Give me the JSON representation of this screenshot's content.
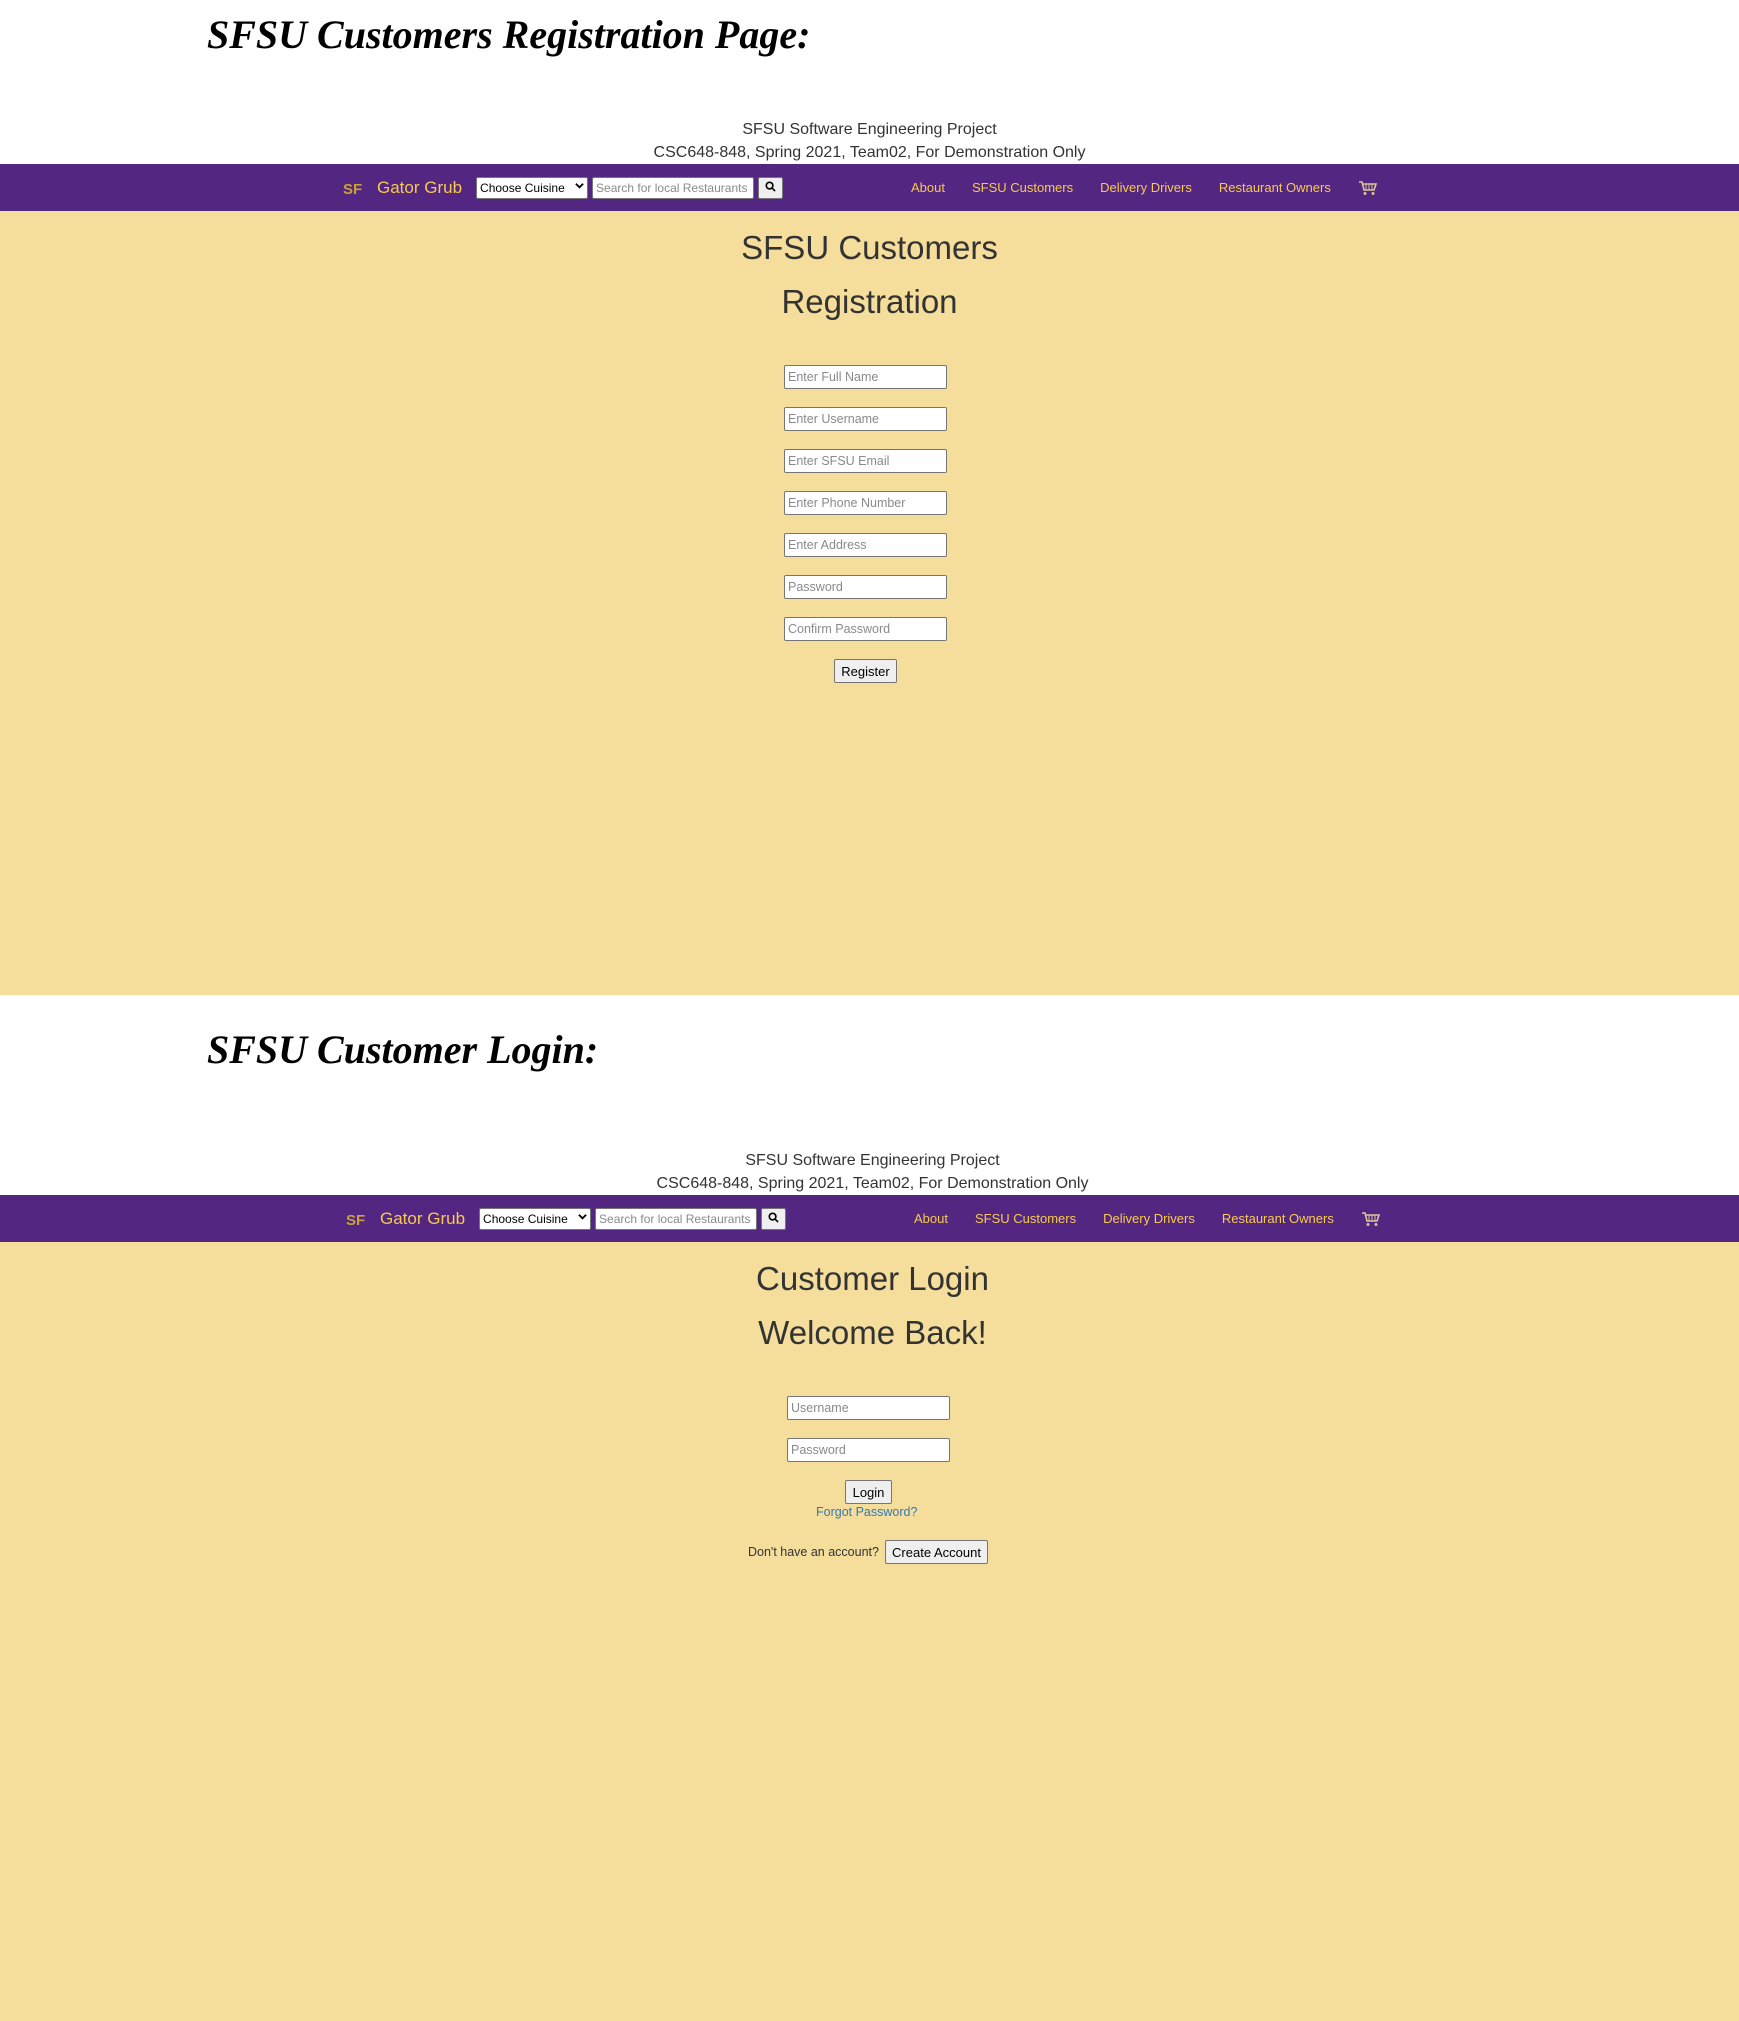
{
  "registration_section": {
    "heading": "SFSU Customers Registration Page:",
    "project_info": {
      "line1": "SFSU Software Engineering Project",
      "line2": "CSC648-848, Spring 2021, Team02, For Demonstration Only"
    },
    "navbar": {
      "brand": "Gator Grub",
      "cuisine_select": "Choose Cuisine",
      "search_placeholder": "Search for local Restaurants",
      "links": [
        "About",
        "SFSU Customers",
        "Delivery Drivers",
        "Restaurant Owners"
      ]
    },
    "title_line1": "SFSU Customers",
    "title_line2": "Registration",
    "fields": [
      {
        "placeholder": "Enter Full Name"
      },
      {
        "placeholder": "Enter Username"
      },
      {
        "placeholder": "Enter SFSU Email"
      },
      {
        "placeholder": "Enter Phone Number"
      },
      {
        "placeholder": "Enter Address"
      },
      {
        "placeholder": "Password"
      },
      {
        "placeholder": "Confirm Password"
      }
    ],
    "register_button": "Register"
  },
  "login_section": {
    "heading": "SFSU Customer Login:",
    "project_info": {
      "line1": "SFSU Software Engineering Project",
      "line2": "CSC648-848, Spring 2021, Team02, For Demonstration Only"
    },
    "navbar": {
      "brand": "Gator Grub",
      "cuisine_select": "Choose Cuisine",
      "search_placeholder": "Search for local Restaurants",
      "links": [
        "About",
        "SFSU Customers",
        "Delivery Drivers",
        "Restaurant Owners"
      ]
    },
    "title_line1": "Customer Login",
    "title_line2": "Welcome Back!",
    "fields": [
      {
        "placeholder": "Username"
      },
      {
        "placeholder": "Password"
      }
    ],
    "login_button": "Login",
    "forgot_password": "Forgot Password?",
    "no_account_text": "Don't have an account?",
    "create_account_button": "Create Account"
  },
  "colors": {
    "navbar_bg": "#532681",
    "navbar_text": "#f7cb4d",
    "panel_bg": "#f5dd9b",
    "link": "#337ab7"
  }
}
